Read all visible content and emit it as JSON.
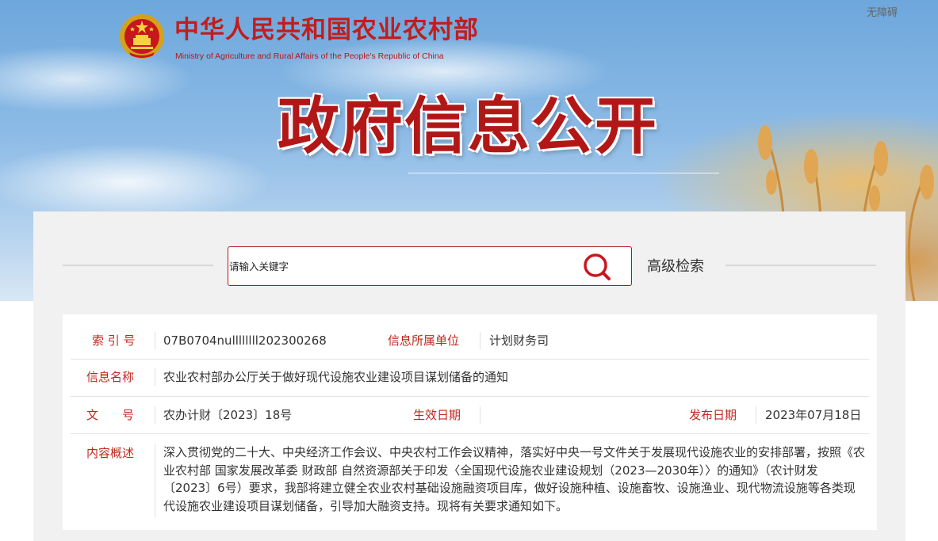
{
  "header": {
    "ministry_cn": "中华人民共和国农业农村部",
    "ministry_en": "Ministry of Agriculture and Rural Affairs of the People's Republic of China",
    "accessibility_label": "无障碍",
    "banner_title": "政府信息公开"
  },
  "search": {
    "placeholder": "请输入关键字",
    "advanced_label": "高级检索"
  },
  "info": {
    "index_label": "索 引 号",
    "index_value": "07B0704nullllllll202300268",
    "unit_label": "信息所属单位",
    "unit_value": "计划财务司",
    "name_label": "信息名称",
    "name_value": "农业农村部办公厅关于做好现代设施农业建设项目谋划储备的通知",
    "docno_label": "文　　号",
    "docno_value": "农办计财〔2023〕18号",
    "effective_label": "生效日期",
    "effective_value": "",
    "publish_label": "发布日期",
    "publish_value": "2023年07月18日",
    "summary_label": "内容概述",
    "summary_value": "深入贯彻党的二十大、中央经济工作会议、中央农村工作会议精神，落实好中央一号文件关于发展现代设施农业的安排部署，按照《农业农村部 国家发展改革委 财政部 自然资源部关于印发〈全国现代设施农业建设规划（2023—2030年）〉的通知》（农计财发〔2023〕6号）要求，我部将建立健全农业农村基础设施融资项目库，做好设施种植、设施畜牧、设施渔业、现代物流设施等各类现代设施农业建设项目谋划储备，引导加大融资支持。现将有关要求通知如下。"
  },
  "colors": {
    "brand_red": "#c21d1d",
    "label_red": "#c0281e",
    "search_border": "#b3141a"
  },
  "icons": [
    "national-emblem-icon",
    "search-icon"
  ]
}
